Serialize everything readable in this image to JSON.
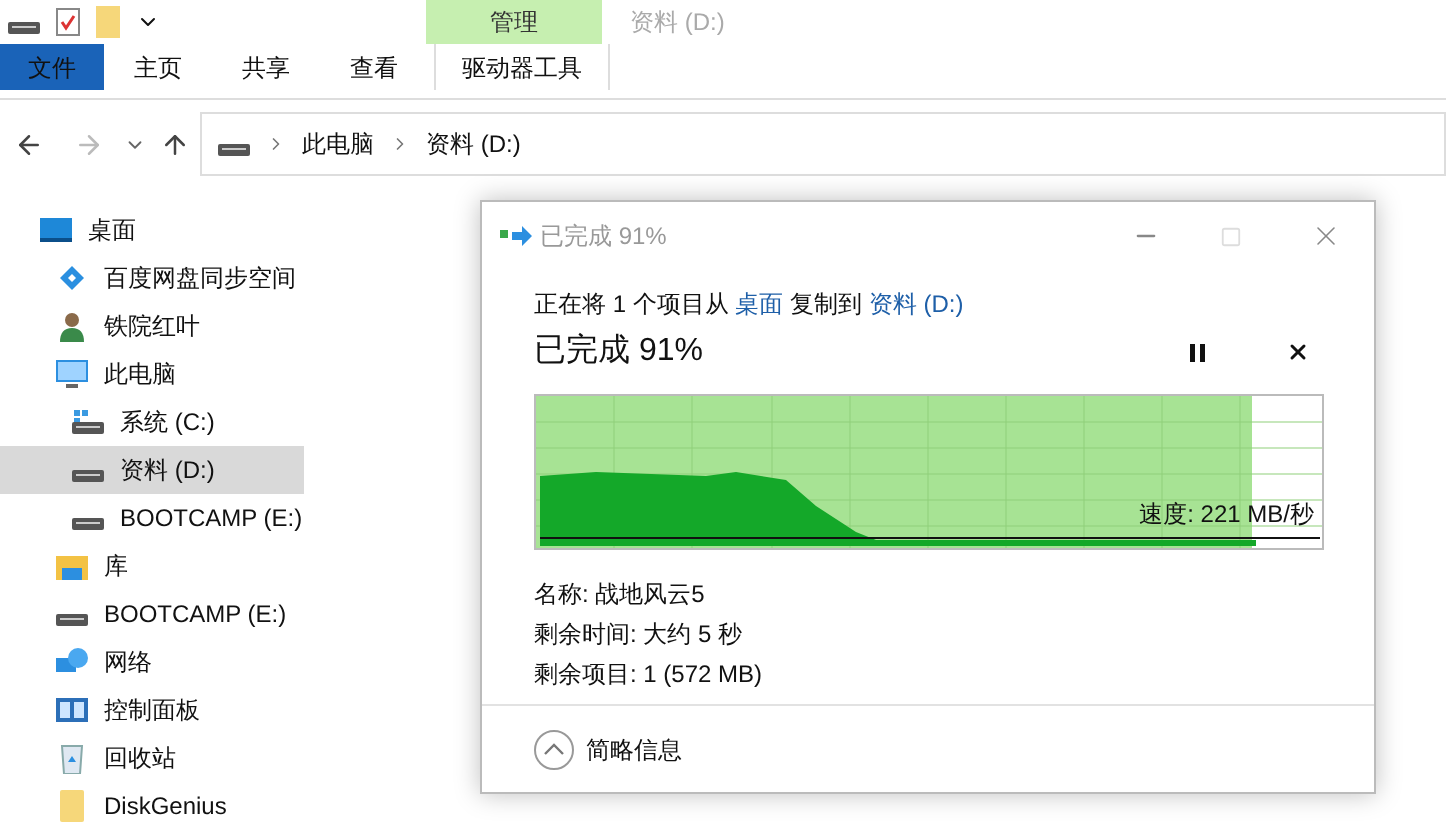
{
  "ribbon": {
    "context_tab": "管理",
    "window_title": "资料 (D:)",
    "tabs": [
      {
        "label": "文件",
        "kind": "file",
        "selected": false
      },
      {
        "label": "主页",
        "kind": "tab",
        "selected": false
      },
      {
        "label": "共享",
        "kind": "tab",
        "selected": false
      },
      {
        "label": "查看",
        "kind": "tab",
        "selected": false
      },
      {
        "label": "驱动器工具",
        "kind": "context",
        "selected": false
      }
    ]
  },
  "address_bar": {
    "path": [
      "此电脑",
      "资料 (D:)"
    ]
  },
  "nav_pane": {
    "items": [
      {
        "label": "桌面",
        "kind": "desktop",
        "selected": false,
        "children": [
          {
            "label": "百度网盘同步空间",
            "kind": "cloud",
            "selected": false
          },
          {
            "label": "铁院红叶",
            "kind": "user",
            "selected": false
          },
          {
            "label": "此电脑",
            "kind": "computer",
            "selected": false,
            "children": [
              {
                "label": "系统 (C:)",
                "kind": "system-drive",
                "selected": false
              },
              {
                "label": "资料 (D:)",
                "kind": "drive",
                "selected": true
              },
              {
                "label": "BOOTCAMP (E:)",
                "kind": "drive",
                "selected": false
              }
            ]
          },
          {
            "label": "库",
            "kind": "library",
            "selected": false
          },
          {
            "label": "BOOTCAMP (E:)",
            "kind": "drive",
            "selected": false
          },
          {
            "label": "网络",
            "kind": "network",
            "selected": false
          },
          {
            "label": "控制面板",
            "kind": "control-panel",
            "selected": false
          },
          {
            "label": "回收站",
            "kind": "recycle",
            "selected": false
          },
          {
            "label": "DiskGenius",
            "kind": "folder",
            "selected": false
          }
        ]
      }
    ]
  },
  "copy_dialog": {
    "title": "已完成 91%",
    "description": {
      "prefix": "正在将 1 个项目从",
      "source": "桌面",
      "middle": "复制到",
      "destination": "资料 (D:)"
    },
    "status": "已完成 91%",
    "level": 0.91,
    "speed": "速度: 221 MB/秒",
    "details": [
      "名称: 战地风云5",
      "剩余时间: 大约 5 秒",
      "剩余项目: 1 (572 MB)"
    ],
    "details_toggle": "简略信息"
  }
}
